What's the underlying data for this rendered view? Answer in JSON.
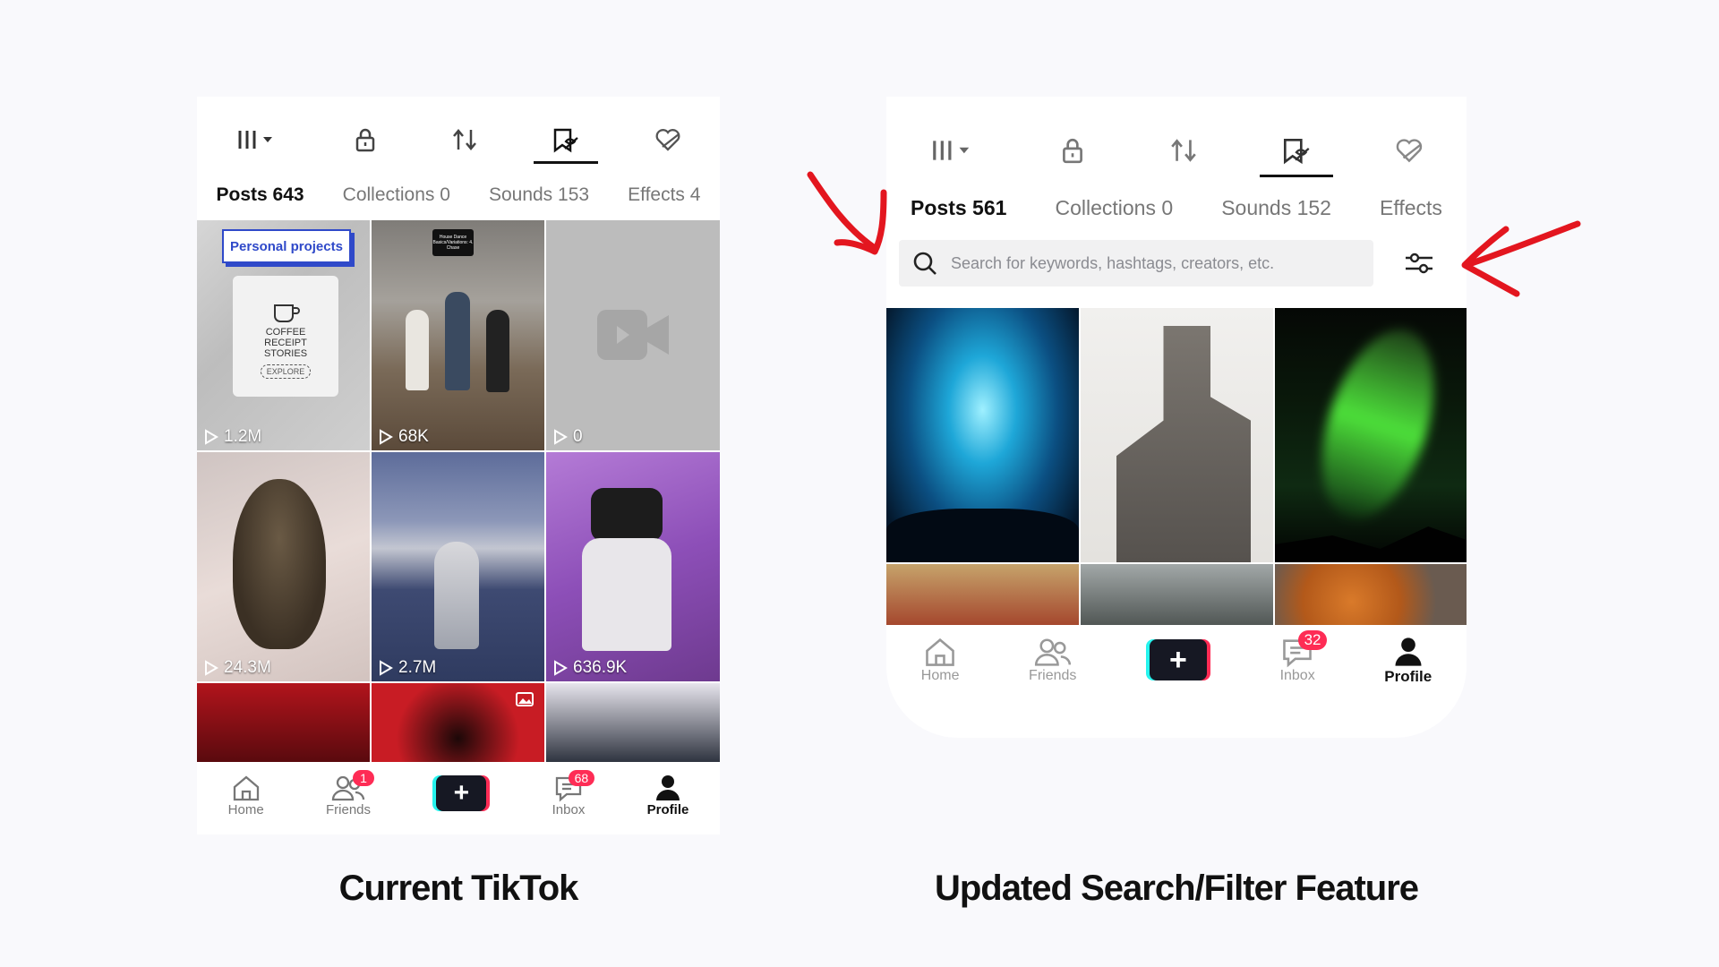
{
  "left": {
    "tabs": [
      {
        "label": "Posts 643",
        "active": true
      },
      {
        "label": "Collections 0",
        "active": false
      },
      {
        "label": "Sounds 153",
        "active": false
      },
      {
        "label": "Effects 4",
        "active": false
      }
    ],
    "header_icons": [
      "grid-menu-icon",
      "lock-icon",
      "repost-icon",
      "liked-icon",
      "favorites-heart-icon"
    ],
    "tiles": [
      {
        "views": "1.2M",
        "overlay_label": "Personal projects",
        "poster_text": "COFFEE RECEIPT STORIES",
        "poster_button": "EXPLORE"
      },
      {
        "views": "68K",
        "overlay_label": "House Dance Basics/Variations: 4. Chase"
      },
      {
        "views": "0"
      },
      {
        "views": "24.3M"
      },
      {
        "views": "2.7M"
      },
      {
        "views": "636.9K"
      },
      {},
      {},
      {}
    ],
    "nav": [
      {
        "label": "Home",
        "icon": "home-icon"
      },
      {
        "label": "Friends",
        "icon": "friends-icon",
        "badge": "1"
      },
      {
        "label": "",
        "icon": "create-plus-icon"
      },
      {
        "label": "Inbox",
        "icon": "inbox-icon",
        "badge": "68"
      },
      {
        "label": "Profile",
        "icon": "profile-icon",
        "active": true
      }
    ]
  },
  "right": {
    "tabs": [
      {
        "label": "Posts 561",
        "active": true
      },
      {
        "label": "Collections 0",
        "active": false
      },
      {
        "label": "Sounds 152",
        "active": false
      },
      {
        "label": "Effects",
        "active": false
      }
    ],
    "search_placeholder": "Search for keywords, hashtags, creators, etc.",
    "nav": [
      {
        "label": "Home",
        "icon": "home-icon"
      },
      {
        "label": "Friends",
        "icon": "friends-icon"
      },
      {
        "label": "",
        "icon": "create-plus-icon"
      },
      {
        "label": "Inbox",
        "icon": "inbox-icon",
        "badge": "32"
      },
      {
        "label": "Profile",
        "icon": "profile-icon",
        "active": true
      }
    ]
  },
  "captions": {
    "left": "Current TikTok",
    "right": "Updated Search/Filter Feature"
  },
  "colors": {
    "accent": "#fe2c55",
    "cyan": "#25f4ee",
    "arrow": "#e3161f"
  }
}
